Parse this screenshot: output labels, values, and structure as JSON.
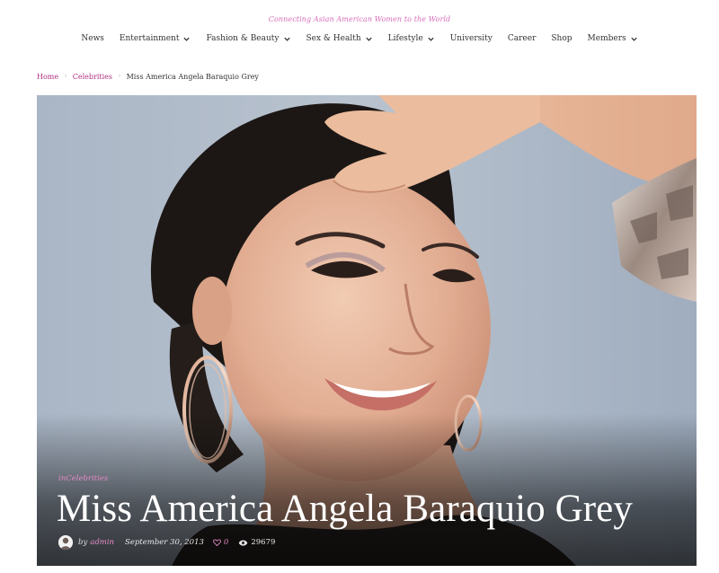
{
  "site": {
    "tagline": "Connecting Asian American Women to the World"
  },
  "nav": {
    "items": [
      {
        "label": "News",
        "dropdown": false
      },
      {
        "label": "Entertainment",
        "dropdown": true
      },
      {
        "label": "Fashion & Beauty",
        "dropdown": true
      },
      {
        "label": "Sex & Health",
        "dropdown": true
      },
      {
        "label": "Lifestyle",
        "dropdown": true
      },
      {
        "label": "University",
        "dropdown": false
      },
      {
        "label": "Career",
        "dropdown": false
      },
      {
        "label": "Shop",
        "dropdown": false
      },
      {
        "label": "Members",
        "dropdown": true
      }
    ]
  },
  "breadcrumb": {
    "home": "Home",
    "category": "Celebrities",
    "current": "Miss America Angela Baraquio Grey"
  },
  "post": {
    "category_prefix": "in",
    "category": "Celebrities",
    "title": "Miss America Angela Baraquio Grey",
    "by": "by",
    "author": "admin",
    "date": "September 30, 2013",
    "likes": "0",
    "views": "29679"
  },
  "colors": {
    "accent": "#b0307f",
    "tagline": "#d86fb9",
    "meta_accent": "#e58ac6"
  },
  "icons": {
    "like": "heart-icon",
    "views": "eye-icon",
    "dropdown": "chevron-down-icon"
  }
}
